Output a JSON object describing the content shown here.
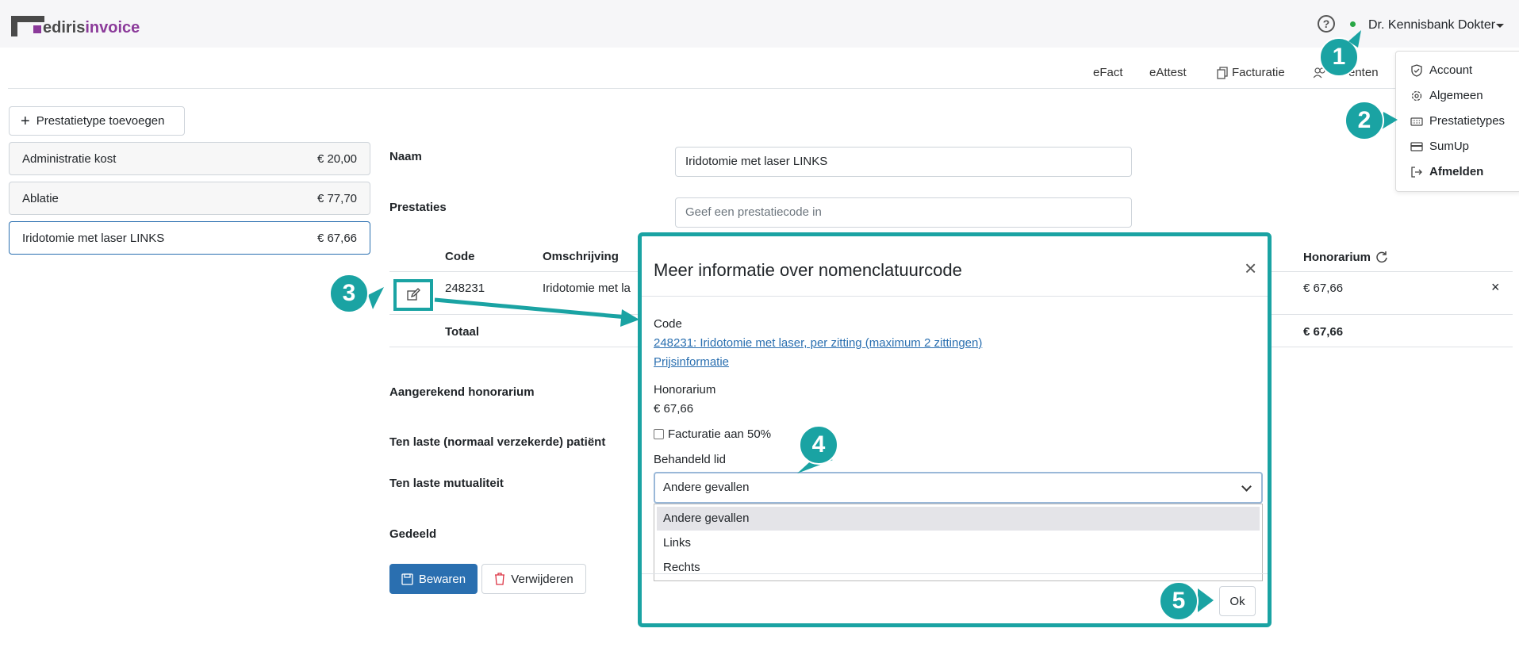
{
  "brand": {
    "logo_plain": "ediris",
    "logo_accent": "invoice"
  },
  "header": {
    "user_name": "Dr. Kennisbank Dokter",
    "help_glyph": "?"
  },
  "nav": {
    "items": [
      "eFact",
      "eAttest",
      "Facturatie",
      "enten"
    ]
  },
  "user_menu": {
    "items": [
      "Account",
      "Algemeen",
      "Prestatietypes",
      "SumUp",
      "Afmelden"
    ]
  },
  "sidebar": {
    "add_label": "Prestatietype toevoegen",
    "items": [
      {
        "name": "Administratie kost",
        "price": "€ 20,00"
      },
      {
        "name": "Ablatie",
        "price": "€ 77,70"
      },
      {
        "name": "Iridotomie met laser LINKS",
        "price": "€ 67,66"
      }
    ]
  },
  "form": {
    "naam_label": "Naam",
    "naam_value": "Iridotomie met laser LINKS",
    "prestaties_label": "Prestaties",
    "prestaties_placeholder": "Geef een prestatiecode in",
    "table": {
      "headers": {
        "code": "Code",
        "omschrijving": "Omschrijving",
        "honorarium": "Honorarium"
      },
      "row": {
        "code": "248231",
        "omschrijving": "Iridotomie met la",
        "honorarium": "€ 67,66"
      },
      "total_label": "Totaal",
      "total_value": "€ 67,66"
    },
    "aangerekend_label": "Aangerekend honorarium",
    "patient_label": "Ten laste (normaal verzekerde) patiënt",
    "mutualiteit_label": "Ten laste mutualiteit",
    "gedeeld_label": "Gedeeld",
    "save_label": "Bewaren",
    "delete_label": "Verwijderen"
  },
  "modal": {
    "title": "Meer informatie over nomenclatuurcode",
    "code_label": "Code",
    "code_link": "248231: Iridotomie met laser, per zitting (maximum 2 zittingen)",
    "price_link": "Prijsinformatie",
    "honorarium_label": "Honorarium",
    "honorarium_value": "€ 67,66",
    "facturatie_label": "Facturatie aan 50%",
    "lid_label": "Behandeld lid",
    "select_value": "Andere gevallen",
    "options": [
      "Andere gevallen",
      "Links",
      "Rechts"
    ],
    "ok_label": "Ok"
  },
  "badges": [
    "1",
    "2",
    "3",
    "4",
    "5"
  ],
  "colors": {
    "accent": "#1aa3a3",
    "primary": "#2a6fb0",
    "brand": "#8b3a9a"
  }
}
